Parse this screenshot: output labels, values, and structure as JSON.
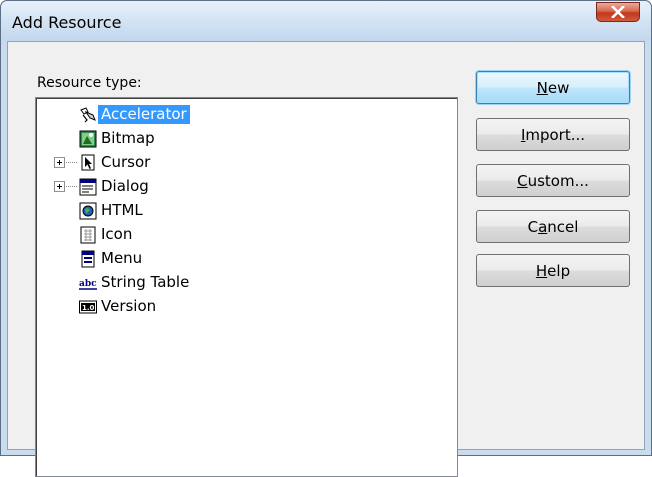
{
  "window": {
    "title": "Add Resource"
  },
  "resource_type": {
    "label": "Resource type:",
    "items": [
      {
        "label": "Accelerator",
        "icon": "accelerator-icon",
        "expandable": false,
        "selected": true
      },
      {
        "label": "Bitmap",
        "icon": "bitmap-icon",
        "expandable": false,
        "selected": false
      },
      {
        "label": "Cursor",
        "icon": "cursor-icon",
        "expandable": true,
        "selected": false
      },
      {
        "label": "Dialog",
        "icon": "dialog-icon",
        "expandable": true,
        "selected": false
      },
      {
        "label": "HTML",
        "icon": "html-icon",
        "expandable": false,
        "selected": false
      },
      {
        "label": "Icon",
        "icon": "icon-resource-icon",
        "expandable": false,
        "selected": false
      },
      {
        "label": "Menu",
        "icon": "menu-icon",
        "expandable": false,
        "selected": false
      },
      {
        "label": "String Table",
        "icon": "string-table-icon",
        "expandable": false,
        "selected": false
      },
      {
        "label": "Version",
        "icon": "version-icon",
        "expandable": false,
        "selected": false
      }
    ]
  },
  "buttons": {
    "new": {
      "pre": "",
      "mnemonic": "N",
      "post": "ew"
    },
    "import": {
      "pre": "",
      "mnemonic": "I",
      "post": "mport..."
    },
    "custom": {
      "pre": "",
      "mnemonic": "C",
      "post": "ustom..."
    },
    "cancel": {
      "pre": "C",
      "mnemonic": "a",
      "post": "ncel"
    },
    "help": {
      "pre": "",
      "mnemonic": "H",
      "post": "elp"
    }
  },
  "icons": {
    "string_table_glyph": "abc",
    "version_glyph": "1.0"
  },
  "colors": {
    "selection": "#3399ff",
    "close_button": "#c2371c",
    "window_frame": "#c9dcee"
  }
}
